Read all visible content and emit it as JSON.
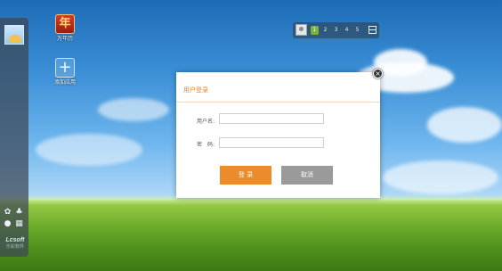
{
  "desktop": {
    "icons": [
      {
        "label": "万年历",
        "glyph": "年",
        "icon": "calendar-icon"
      },
      {
        "label": "添加应用",
        "glyph": "+",
        "icon": "add-app-icon"
      }
    ]
  },
  "dock": {
    "tools": [
      {
        "icon": "gear-icon",
        "glyph": "✿"
      },
      {
        "icon": "theme-icon",
        "glyph": "♣"
      },
      {
        "icon": "globe-icon",
        "glyph": "●"
      },
      {
        "icon": "grid-icon",
        "glyph": "▦"
      }
    ],
    "logo": "Lcsoft",
    "logo_sub": "乐彩软件"
  },
  "pager": {
    "pages": [
      "1",
      "2",
      "3",
      "4",
      "5"
    ],
    "active_page": "1"
  },
  "login": {
    "title": "用户登录",
    "close_glyph": "×",
    "username_label": "用户名:",
    "username_value": "",
    "password_label": "密　码:",
    "password_value": "",
    "login_button": "登 录",
    "cancel_button": "取消"
  }
}
